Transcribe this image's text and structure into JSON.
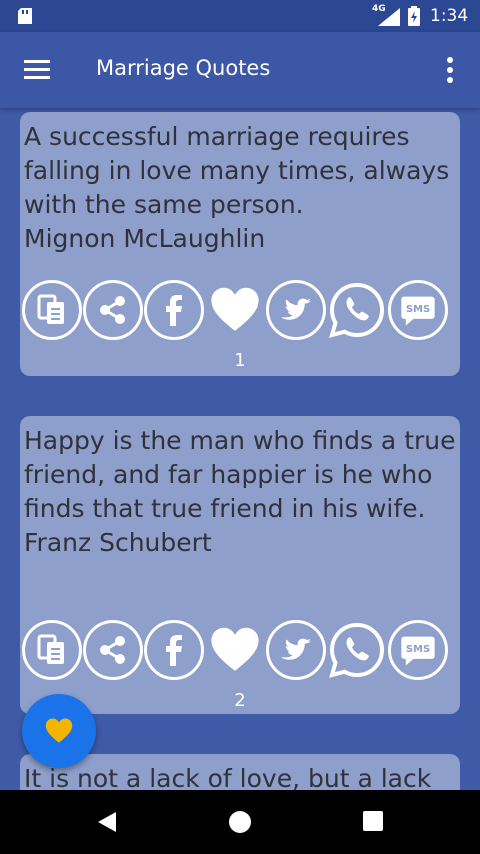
{
  "status": {
    "network": "4G",
    "time": "1:34"
  },
  "app_bar": {
    "title": "Marriage Quotes"
  },
  "icons": {
    "copy": "copy-icon",
    "share": "share-icon",
    "facebook": "facebook-icon",
    "favorite": "heart-icon",
    "twitter": "twitter-icon",
    "whatsapp": "whatsapp-icon",
    "sms": "sms-icon"
  },
  "colors": {
    "background": "#3f5aa6",
    "card": "#8e9fcb",
    "fab": "#1a73e8",
    "fab_heart": "#f4b400"
  },
  "sms_label": "SMS",
  "quotes": [
    {
      "text": "A successful marriage requires falling in love many times, always with the same person.",
      "author": "Mignon McLaughlin",
      "number": "1"
    },
    {
      "text": "Happy is the man who finds a true friend, and far happier is he who finds that true friend in his wife.",
      "author": "Franz Schubert",
      "number": "2"
    },
    {
      "text": "It is not a lack of love, but a lack"
    }
  ]
}
